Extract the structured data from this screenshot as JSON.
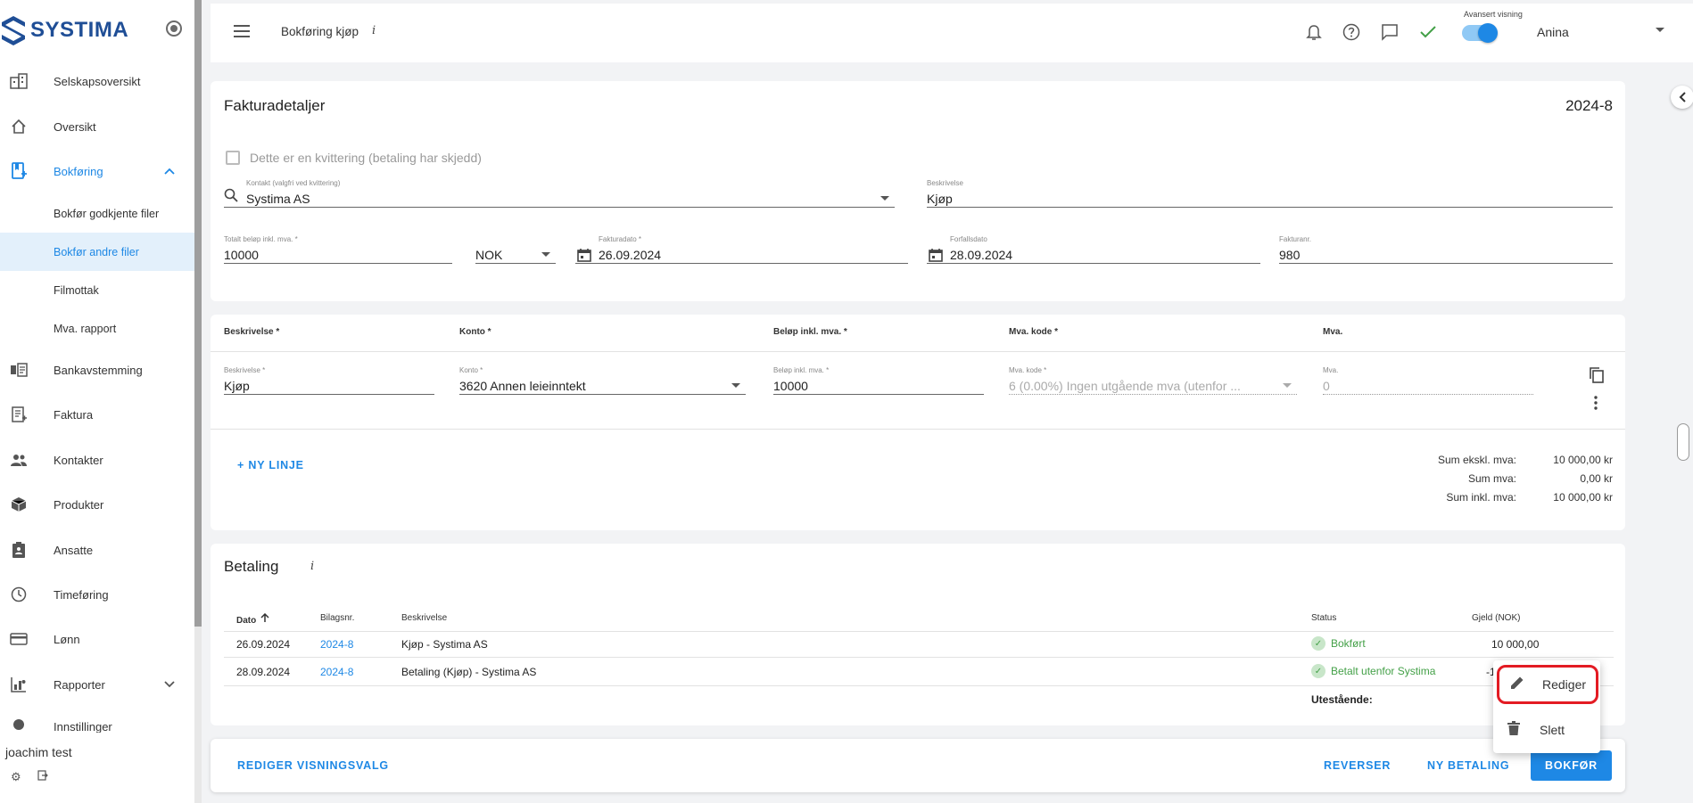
{
  "app": {
    "logo_text": "SYSTIMA"
  },
  "sidebar": {
    "items": [
      {
        "label": "Selskapsoversikt",
        "icon": "building-icon"
      },
      {
        "label": "Oversikt",
        "icon": "home-icon"
      },
      {
        "label": "Bokføring",
        "icon": "book-add-icon",
        "expanded": true
      },
      {
        "label": "Bankavstemming",
        "icon": "bank-icon"
      },
      {
        "label": "Faktura",
        "icon": "invoice-icon"
      },
      {
        "label": "Kontakter",
        "icon": "people-icon"
      },
      {
        "label": "Produkter",
        "icon": "box-icon"
      },
      {
        "label": "Ansatte",
        "icon": "badge-icon"
      },
      {
        "label": "Timeføring",
        "icon": "clock-icon"
      },
      {
        "label": "Lønn",
        "icon": "card-icon"
      },
      {
        "label": "Rapporter",
        "icon": "chart-icon"
      },
      {
        "label": "Innstillinger",
        "icon": "gear-icon"
      }
    ],
    "subitems": [
      {
        "label": "Bokfør godkjente filer"
      },
      {
        "label": "Bokfør andre filer"
      },
      {
        "label": "Filmottak"
      },
      {
        "label": "Mva. rapport"
      }
    ],
    "user": "joachim test"
  },
  "header": {
    "title": "Bokføring kjøp",
    "info": "i",
    "advanced_label": "Avansert visning",
    "advanced_on": true,
    "user": "Anina"
  },
  "invoice": {
    "title": "Fakturadetaljer",
    "number": "2024-8",
    "receipt_label": "Dette er en kvittering (betaling har skjedd)",
    "contact_label": "Kontakt (valgfri ved kvittering)",
    "contact_value": "Systima AS",
    "description_label": "Beskrivelse",
    "description_value": "Kjøp",
    "total_label": "Totalt beløp inkl. mva. *",
    "total_value": "10000",
    "currency": "NOK",
    "invoice_date_label": "Fakturadato *",
    "invoice_date": "26.09.2024",
    "due_date_label": "Forfallsdato",
    "due_date": "28.09.2024",
    "invoice_no_label": "Fakturanr.",
    "invoice_no": "980"
  },
  "lines": {
    "headers": [
      "Beskrivelse *",
      "Konto *",
      "Beløp inkl. mva. *",
      "Mva. kode *",
      "Mva."
    ],
    "row": {
      "desc_label": "Beskrivelse *",
      "desc": "Kjøp",
      "account_label": "Konto *",
      "account": "3620 Annen leieinntekt",
      "amount_label": "Beløp inkl. mva. *",
      "amount": "10000",
      "vat_code_label": "Mva. kode *",
      "vat_code": "6 (0.00%) Ingen utgående mva (utenfor ...",
      "vat_label": "Mva.",
      "vat": "0"
    },
    "add_line": "+ NY LINJE",
    "sums": [
      {
        "label": "Sum ekskl. mva:",
        "value": "10 000,00 kr"
      },
      {
        "label": "Sum mva:",
        "value": "0,00 kr"
      },
      {
        "label": "Sum inkl. mva:",
        "value": "10 000,00 kr"
      }
    ]
  },
  "payment": {
    "title": "Betaling",
    "info": "i",
    "headers": [
      "Dato",
      "Bilagsnr.",
      "Beskrivelse",
      "Status",
      "Gjeld (NOK)"
    ],
    "rows": [
      {
        "date": "26.09.2024",
        "voucher": "2024-8",
        "desc": "Kjøp - Systima AS",
        "status": "Bokført",
        "debt": "10 000,00"
      },
      {
        "date": "28.09.2024",
        "voucher": "2024-8",
        "desc": "Betaling (Kjøp) - Systima AS",
        "status": "Betalt utenfor Systima",
        "debt": "-1"
      }
    ],
    "outstanding_label": "Utestående:"
  },
  "footer": {
    "edit_view": "REDIGER VISNINGSVALG",
    "reverse": "REVERSER",
    "new_payment": "NY BETALING",
    "post": "BOKFØR"
  },
  "context_menu": {
    "edit": "Rediger",
    "delete": "Slett"
  },
  "colors": {
    "accent": "#1e88e5",
    "brand": "#1f4e96",
    "success": "#43a047",
    "highlight": "#e31b23"
  }
}
